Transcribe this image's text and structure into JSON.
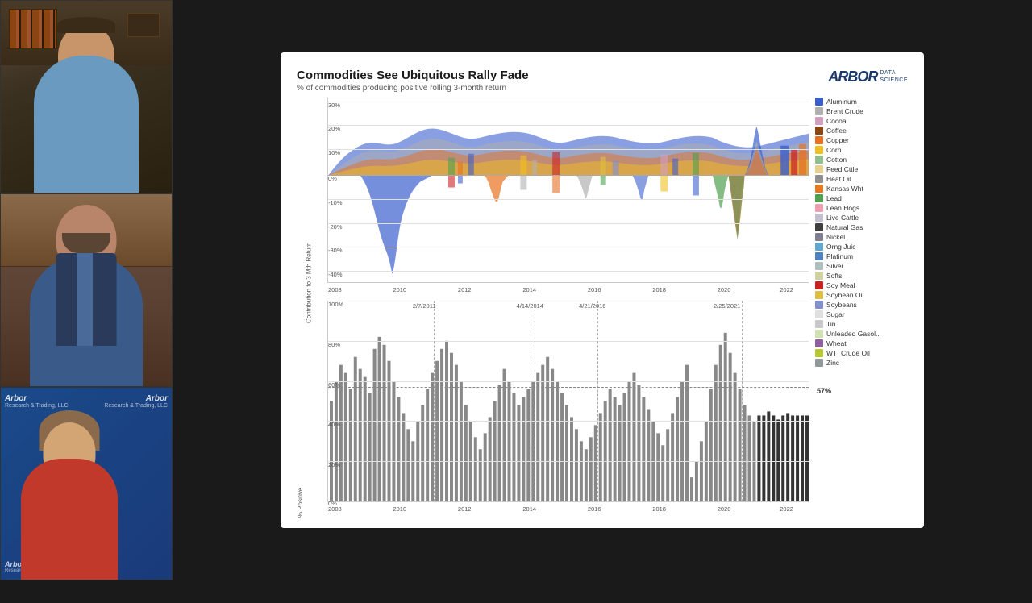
{
  "sidebar": {
    "panels": [
      {
        "id": "panel-1",
        "label": "Presenter 1 - Man in blue shirt"
      },
      {
        "id": "panel-2",
        "label": "Presenter 2 - Man in blue vest"
      },
      {
        "id": "panel-3",
        "label": "Presenter 3 - Woman with Arbor branding"
      }
    ],
    "arbor_watermark": "Arbor Research & Trading, LLC"
  },
  "slide": {
    "title": "Commodities See Ubiquitous Rally Fade",
    "subtitle": "% of commodities producing positive rolling 3-month return",
    "brand_name": "ARBOR",
    "brand_sub": "DATA\nSCIENCE",
    "chart_top": {
      "y_axis_label": "Contribution to 3 Mth Return",
      "y_ticks": [
        "30%",
        "20%",
        "10%",
        "0%",
        "-10%",
        "-20%",
        "-30%",
        "-40%"
      ],
      "x_ticks": [
        "2008",
        "2010",
        "2012",
        "2014",
        "2016",
        "2018",
        "2020",
        "2022"
      ]
    },
    "chart_bottom": {
      "y_axis_label": "% Positive",
      "y_ticks": [
        "100%",
        "80%",
        "60%",
        "40%",
        "20%",
        "0%"
      ],
      "x_ticks": [
        "2008",
        "2010",
        "2012",
        "2014",
        "2016",
        "2018",
        "2020",
        "2022"
      ],
      "annotations": [
        {
          "label": "2/7/2011",
          "x_pct": 22
        },
        {
          "label": "4/14/2014",
          "x_pct": 43
        },
        {
          "label": "4/21/2016",
          "x_pct": 56
        },
        {
          "label": "2/25/2021",
          "x_pct": 86
        }
      ],
      "current_pct": "57%"
    },
    "legend": [
      {
        "label": "Aluminum",
        "color": "#3a5fcd"
      },
      {
        "label": "Brent Crude",
        "color": "#b0b0b0"
      },
      {
        "label": "Cocoa",
        "color": "#d4a0c0"
      },
      {
        "label": "Coffee",
        "color": "#8b4513"
      },
      {
        "label": "Copper",
        "color": "#e87020"
      },
      {
        "label": "Corn",
        "color": "#f0c020"
      },
      {
        "label": "Cotton",
        "color": "#90c090"
      },
      {
        "label": "Feed Cttle",
        "color": "#e8d090"
      },
      {
        "label": "Heat Oil",
        "color": "#909090"
      },
      {
        "label": "Kansas Wht",
        "color": "#e87820"
      },
      {
        "label": "Lead",
        "color": "#50a050"
      },
      {
        "label": "Lean Hogs",
        "color": "#f0a0b0"
      },
      {
        "label": "Live Cattle",
        "color": "#c0c0d0"
      },
      {
        "label": "Natural Gas",
        "color": "#404040"
      },
      {
        "label": "Nickel",
        "color": "#808090"
      },
      {
        "label": "Orng Juic",
        "color": "#60a8d0"
      },
      {
        "label": "Platinum",
        "color": "#5080c0"
      },
      {
        "label": "Silver",
        "color": "#b0c0c0"
      },
      {
        "label": "Softs",
        "color": "#d0d0a0"
      },
      {
        "label": "Soy Meal",
        "color": "#cc2020"
      },
      {
        "label": "Soybean Oil",
        "color": "#e0c040"
      },
      {
        "label": "Soybeans",
        "color": "#8090d0"
      },
      {
        "label": "Sugar",
        "color": "#e0e0e0"
      },
      {
        "label": "Tin",
        "color": "#c8c8c8"
      },
      {
        "label": "Unleaded Gasol..",
        "color": "#d0e0b0"
      },
      {
        "label": "Wheat",
        "color": "#9060a0"
      },
      {
        "label": "WTI Crude Oil",
        "color": "#b8c830"
      },
      {
        "label": "Zinc",
        "color": "#909898"
      }
    ]
  }
}
